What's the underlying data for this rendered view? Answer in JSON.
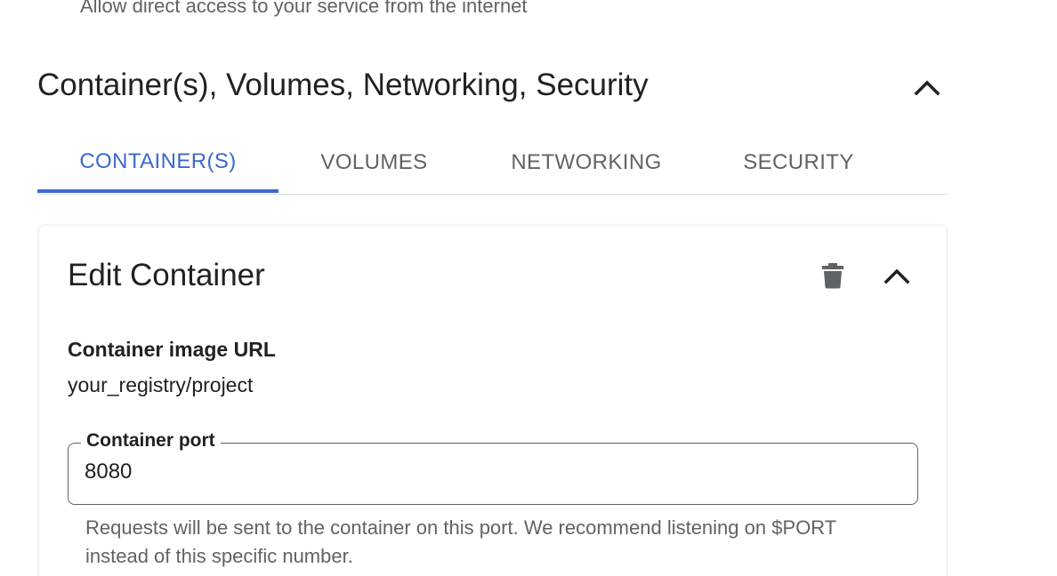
{
  "ingress": {
    "hint": "Allow direct access to your service from the internet"
  },
  "section": {
    "title": "Container(s), Volumes, Networking, Security",
    "collapse_icon": "chevron-up-icon"
  },
  "tabs": [
    {
      "label": "CONTAINER(S)",
      "active": true
    },
    {
      "label": "VOLUMES",
      "active": false
    },
    {
      "label": "NETWORKING",
      "active": false
    },
    {
      "label": "SECURITY",
      "active": false
    }
  ],
  "edit_container": {
    "title": "Edit Container",
    "delete_icon": "trash-icon",
    "collapse_icon": "chevron-up-icon",
    "image_url": {
      "label": "Container image URL",
      "value": "your_registry/project"
    },
    "port": {
      "label": "Container port",
      "value": "8080",
      "helper": "Requests will be sent to the container on this port. We recommend listening on $PORT instead of this specific number."
    }
  },
  "colors": {
    "accent": "#3b68d0",
    "text_primary": "#202124",
    "text_secondary": "#5f6368",
    "divider": "#dadce0"
  }
}
